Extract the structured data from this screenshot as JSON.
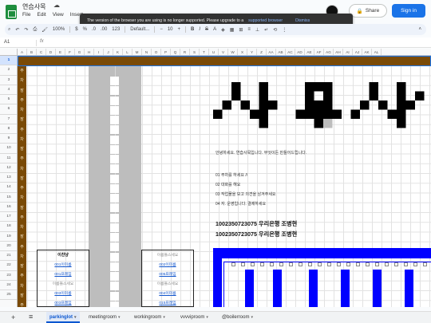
{
  "app": {
    "doc_title": "연습사목",
    "menu": [
      "File",
      "Edit",
      "View",
      "Insert"
    ],
    "share_label": "Share",
    "signin_label": "Sign in"
  },
  "banner": {
    "message": "The version of the browser you are using is no longer supported. Please upgrade to a",
    "link_label": "supported browser",
    "dismiss_label": "Dismiss"
  },
  "toolbar": {
    "zoom": "100%",
    "font": "Default...",
    "font_size": "10",
    "undo_icon": "undo-icon",
    "redo_icon": "redo-icon",
    "print_icon": "print-icon",
    "paint_icon": "paint-format-icon"
  },
  "formula_bar": {
    "name_box": "A1",
    "fx": "fx",
    "value": ""
  },
  "grid": {
    "columns": [
      "A",
      "B",
      "C",
      "D",
      "E",
      "F",
      "G",
      "H",
      "I",
      "J",
      "K",
      "L",
      "M",
      "N",
      "O",
      "P",
      "Q",
      "R",
      "S",
      "T",
      "U",
      "V",
      "W",
      "X",
      "Y",
      "Z",
      "AA",
      "AB",
      "AC",
      "AD",
      "AE",
      "AF",
      "AG",
      "AH",
      "AI",
      "AJ",
      "AK",
      "AL"
    ],
    "rows": [
      "1",
      "2",
      "3",
      "4",
      "5",
      "6",
      "7",
      "8",
      "9",
      "10",
      "11",
      "12",
      "13",
      "14",
      "15",
      "16",
      "17",
      "18",
      "19",
      "20",
      "21",
      "22",
      "23",
      "24",
      "25"
    ],
    "selected_row": "1",
    "vertical_text": [
      "주",
      "차",
      "장",
      "주",
      "차",
      "장",
      "주",
      "차",
      "장",
      "주",
      "차",
      "장",
      "주",
      "차",
      "장",
      "주",
      "차",
      "장",
      "주",
      "차",
      "장",
      "주",
      "차",
      "장",
      "주"
    ]
  },
  "content": {
    "intro": "안녕하세요. 연습사목입니다. 무엇이든 만들어드립니다.",
    "items": [
      "01 주차를 하세요 //",
      "02 대화를 해요",
      "03 작업물을 보고 의견을 남겨주세요",
      "04 자. 운영입니다. 결제하세요"
    ],
    "account_lines": [
      "1002350723075 우리은행 조병현",
      "1002350723075 우리은행 조병현"
    ]
  },
  "left_table": {
    "header": "이찬냥",
    "cells": [
      "001이미름",
      "001프레임",
      "이름들스세요",
      "003이미름",
      "003프레임"
    ]
  },
  "right_table": {
    "header": "이름들스세요",
    "cells": [
      "002이미름",
      "005프레임",
      "이름들스세요",
      "004이미름",
      "015프레임"
    ]
  },
  "tabs": [
    "parkinglot",
    "meetingroom",
    "workingroom",
    "vvvviproom",
    "@boilerroom"
  ],
  "active_tab": "parkinglot",
  "colors": {
    "brown": "#7a4a06",
    "blue": "#0000ff",
    "gray": "#bdbdbd",
    "accent": "#1a73e8"
  }
}
